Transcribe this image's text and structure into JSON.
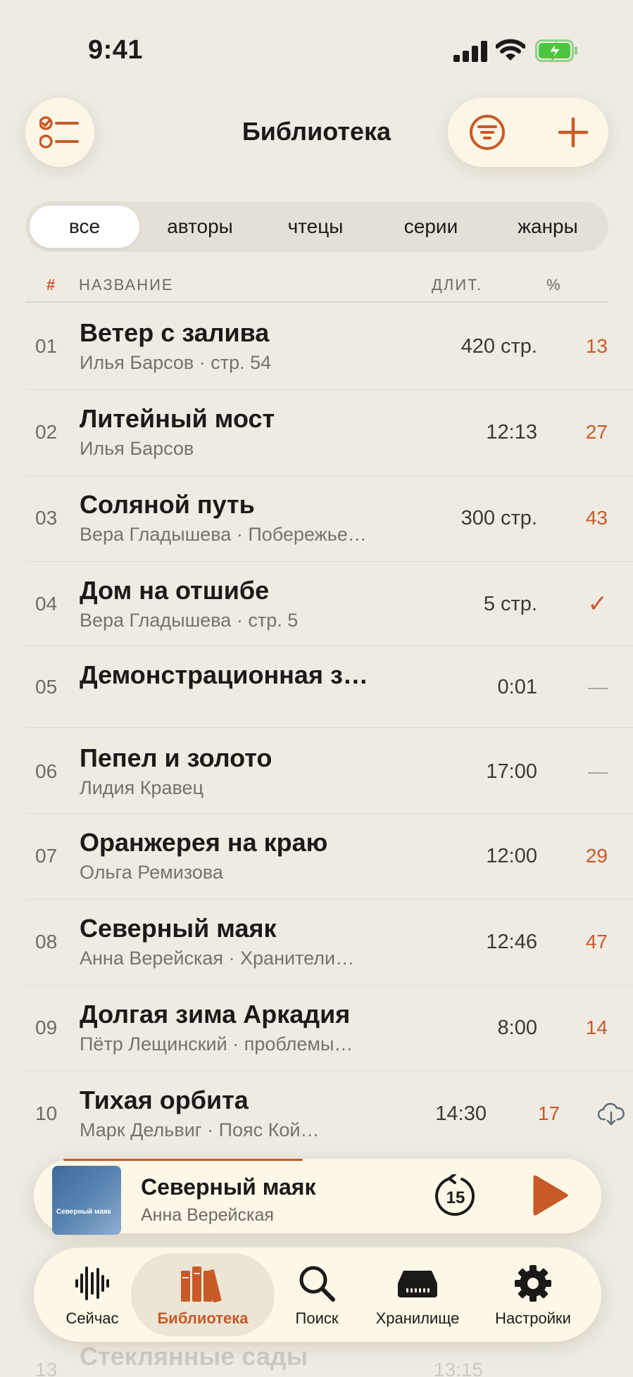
{
  "status_bar": {
    "time": "9:41"
  },
  "header": {
    "title": "Библиотека"
  },
  "segments": [
    "все",
    "авторы",
    "чтецы",
    "серии",
    "жанры"
  ],
  "table_header": {
    "num": "#",
    "name": "НАЗВАНИЕ",
    "duration": "ДЛИТ.",
    "percent": "%"
  },
  "rows": [
    {
      "num": "01",
      "title": "Ветер с залива",
      "sub": "Илья Барсов · стр. 54",
      "duration": "420 стр.",
      "progress": "13"
    },
    {
      "num": "02",
      "title": "Литейный мост",
      "sub": "Илья Барсов",
      "duration": "12:13",
      "progress": "27"
    },
    {
      "num": "03",
      "title": "Соляной путь",
      "sub": "Вера Гладышева · Побережье…",
      "duration": "300 стр.",
      "progress": "43"
    },
    {
      "num": "04",
      "title": "Дом на отшибе",
      "sub": "Вера Гладышева · стр. 5",
      "duration": "5 стр.",
      "progress": "✓"
    },
    {
      "num": "05",
      "title": "Демонстрационная з…",
      "sub": "",
      "duration": "0:01",
      "progress": "—"
    },
    {
      "num": "06",
      "title": "Пепел и золото",
      "sub": "Лидия Кравец",
      "duration": "17:00",
      "progress": "—"
    },
    {
      "num": "07",
      "title": "Оранжерея на краю",
      "sub": "Ольга Ремизова",
      "duration": "12:00",
      "progress": "29"
    },
    {
      "num": "08",
      "title": "Северный маяк",
      "sub": "Анна Верейская · Хранители…",
      "duration": "12:46",
      "progress": "47"
    },
    {
      "num": "09",
      "title": "Долгая зима Аркадия",
      "sub": "Пётр Лещинский · проблемы…",
      "duration": "8:00",
      "progress": "14"
    },
    {
      "num": "10",
      "title": "Тихая орбита",
      "sub": "Марк Дельвиг · Пояс Кой…",
      "duration": "14:30",
      "progress": "17",
      "icon": "cloud-download-icon"
    }
  ],
  "now_playing": {
    "cover_text": "Северный маяк",
    "title": "Северный маяк",
    "author": "Анна Верейская",
    "skip_seconds": "15"
  },
  "tabs": [
    {
      "label": "Сейчас",
      "icon": "waveform-icon"
    },
    {
      "label": "Библиотека",
      "icon": "books-icon",
      "active": true
    },
    {
      "label": "Поиск",
      "icon": "search-icon"
    },
    {
      "label": "Хранилище",
      "icon": "storage-drive-icon"
    },
    {
      "label": "Настройки",
      "icon": "gear-icon"
    }
  ],
  "ghost_row": {
    "num": "13",
    "title": "Стеклянные сады",
    "duration": "13:15"
  },
  "colors": {
    "accent": "#c85a28",
    "background": "#efebe3",
    "card": "#fcf6e6"
  }
}
